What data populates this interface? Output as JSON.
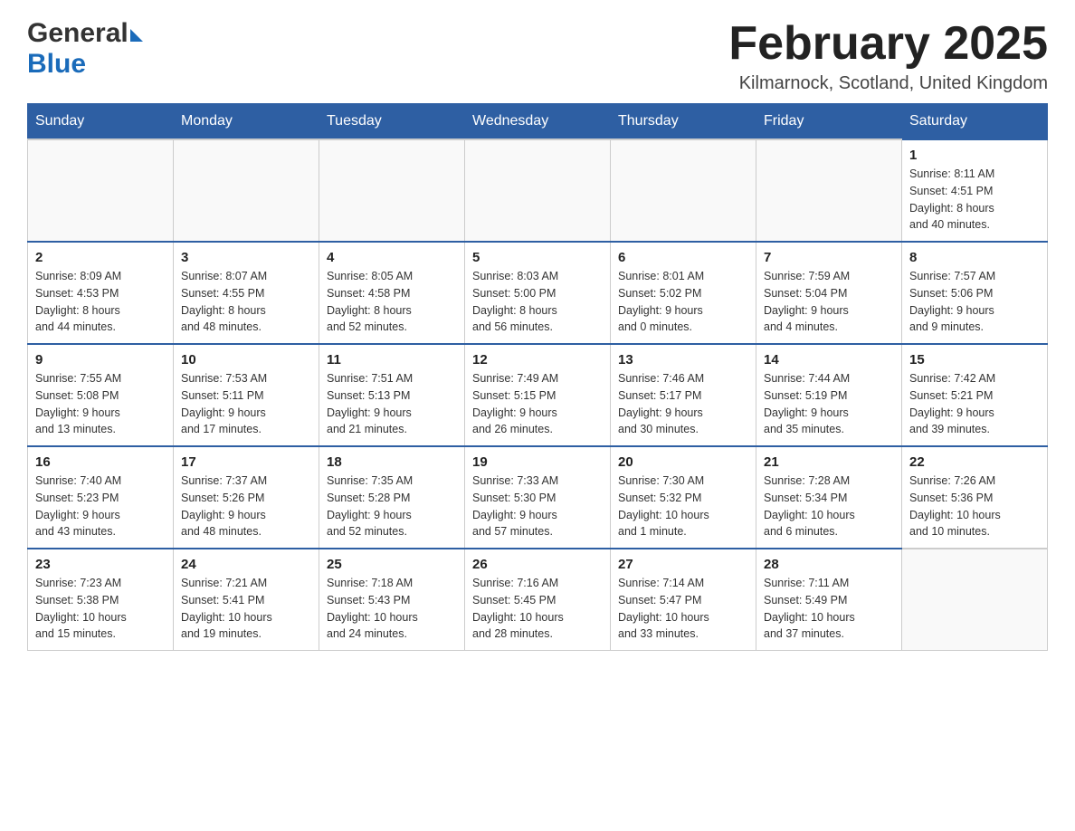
{
  "header": {
    "logo_general": "General",
    "logo_blue": "Blue",
    "title": "February 2025",
    "location": "Kilmarnock, Scotland, United Kingdom"
  },
  "weekdays": [
    "Sunday",
    "Monday",
    "Tuesday",
    "Wednesday",
    "Thursday",
    "Friday",
    "Saturday"
  ],
  "weeks": [
    [
      {
        "day": "",
        "info": ""
      },
      {
        "day": "",
        "info": ""
      },
      {
        "day": "",
        "info": ""
      },
      {
        "day": "",
        "info": ""
      },
      {
        "day": "",
        "info": ""
      },
      {
        "day": "",
        "info": ""
      },
      {
        "day": "1",
        "info": "Sunrise: 8:11 AM\nSunset: 4:51 PM\nDaylight: 8 hours\nand 40 minutes."
      }
    ],
    [
      {
        "day": "2",
        "info": "Sunrise: 8:09 AM\nSunset: 4:53 PM\nDaylight: 8 hours\nand 44 minutes."
      },
      {
        "day": "3",
        "info": "Sunrise: 8:07 AM\nSunset: 4:55 PM\nDaylight: 8 hours\nand 48 minutes."
      },
      {
        "day": "4",
        "info": "Sunrise: 8:05 AM\nSunset: 4:58 PM\nDaylight: 8 hours\nand 52 minutes."
      },
      {
        "day": "5",
        "info": "Sunrise: 8:03 AM\nSunset: 5:00 PM\nDaylight: 8 hours\nand 56 minutes."
      },
      {
        "day": "6",
        "info": "Sunrise: 8:01 AM\nSunset: 5:02 PM\nDaylight: 9 hours\nand 0 minutes."
      },
      {
        "day": "7",
        "info": "Sunrise: 7:59 AM\nSunset: 5:04 PM\nDaylight: 9 hours\nand 4 minutes."
      },
      {
        "day": "8",
        "info": "Sunrise: 7:57 AM\nSunset: 5:06 PM\nDaylight: 9 hours\nand 9 minutes."
      }
    ],
    [
      {
        "day": "9",
        "info": "Sunrise: 7:55 AM\nSunset: 5:08 PM\nDaylight: 9 hours\nand 13 minutes."
      },
      {
        "day": "10",
        "info": "Sunrise: 7:53 AM\nSunset: 5:11 PM\nDaylight: 9 hours\nand 17 minutes."
      },
      {
        "day": "11",
        "info": "Sunrise: 7:51 AM\nSunset: 5:13 PM\nDaylight: 9 hours\nand 21 minutes."
      },
      {
        "day": "12",
        "info": "Sunrise: 7:49 AM\nSunset: 5:15 PM\nDaylight: 9 hours\nand 26 minutes."
      },
      {
        "day": "13",
        "info": "Sunrise: 7:46 AM\nSunset: 5:17 PM\nDaylight: 9 hours\nand 30 minutes."
      },
      {
        "day": "14",
        "info": "Sunrise: 7:44 AM\nSunset: 5:19 PM\nDaylight: 9 hours\nand 35 minutes."
      },
      {
        "day": "15",
        "info": "Sunrise: 7:42 AM\nSunset: 5:21 PM\nDaylight: 9 hours\nand 39 minutes."
      }
    ],
    [
      {
        "day": "16",
        "info": "Sunrise: 7:40 AM\nSunset: 5:23 PM\nDaylight: 9 hours\nand 43 minutes."
      },
      {
        "day": "17",
        "info": "Sunrise: 7:37 AM\nSunset: 5:26 PM\nDaylight: 9 hours\nand 48 minutes."
      },
      {
        "day": "18",
        "info": "Sunrise: 7:35 AM\nSunset: 5:28 PM\nDaylight: 9 hours\nand 52 minutes."
      },
      {
        "day": "19",
        "info": "Sunrise: 7:33 AM\nSunset: 5:30 PM\nDaylight: 9 hours\nand 57 minutes."
      },
      {
        "day": "20",
        "info": "Sunrise: 7:30 AM\nSunset: 5:32 PM\nDaylight: 10 hours\nand 1 minute."
      },
      {
        "day": "21",
        "info": "Sunrise: 7:28 AM\nSunset: 5:34 PM\nDaylight: 10 hours\nand 6 minutes."
      },
      {
        "day": "22",
        "info": "Sunrise: 7:26 AM\nSunset: 5:36 PM\nDaylight: 10 hours\nand 10 minutes."
      }
    ],
    [
      {
        "day": "23",
        "info": "Sunrise: 7:23 AM\nSunset: 5:38 PM\nDaylight: 10 hours\nand 15 minutes."
      },
      {
        "day": "24",
        "info": "Sunrise: 7:21 AM\nSunset: 5:41 PM\nDaylight: 10 hours\nand 19 minutes."
      },
      {
        "day": "25",
        "info": "Sunrise: 7:18 AM\nSunset: 5:43 PM\nDaylight: 10 hours\nand 24 minutes."
      },
      {
        "day": "26",
        "info": "Sunrise: 7:16 AM\nSunset: 5:45 PM\nDaylight: 10 hours\nand 28 minutes."
      },
      {
        "day": "27",
        "info": "Sunrise: 7:14 AM\nSunset: 5:47 PM\nDaylight: 10 hours\nand 33 minutes."
      },
      {
        "day": "28",
        "info": "Sunrise: 7:11 AM\nSunset: 5:49 PM\nDaylight: 10 hours\nand 37 minutes."
      },
      {
        "day": "",
        "info": ""
      }
    ]
  ]
}
